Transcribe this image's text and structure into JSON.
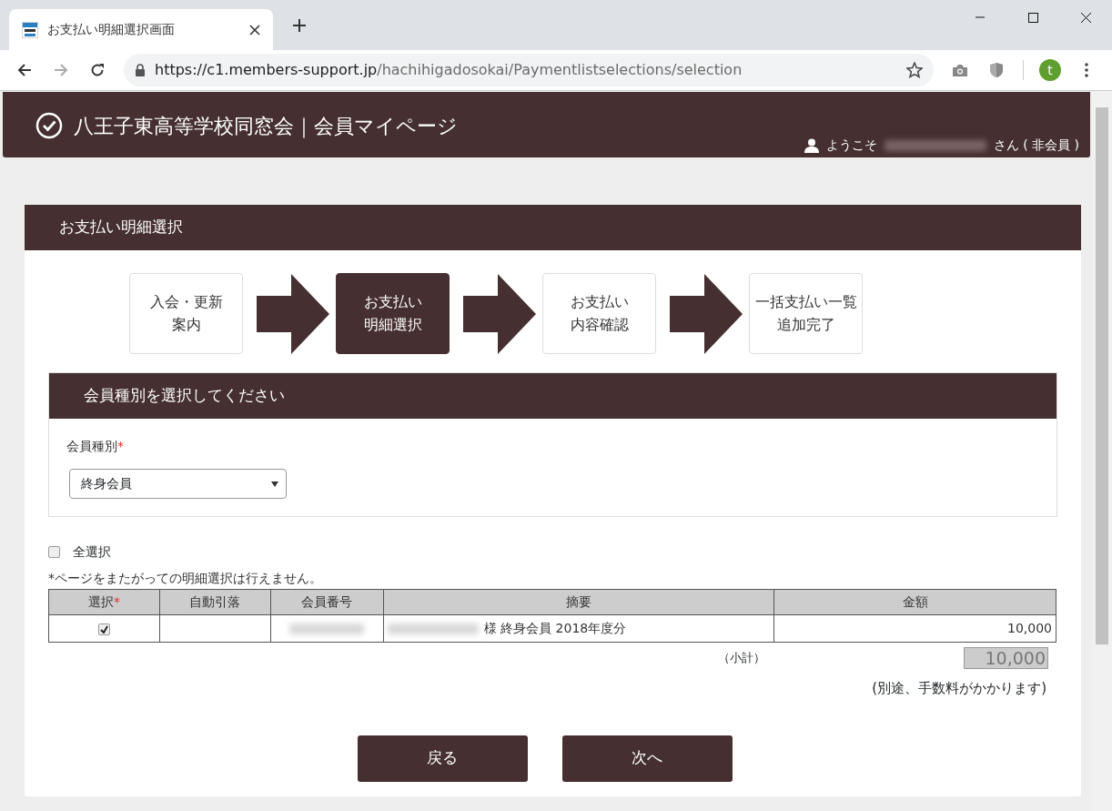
{
  "browser": {
    "tab_title": "お支払い明細選択画面",
    "url_host": "https://c1.members-support.jp",
    "url_path": "/hachihigadosokai/Paymentlistselections/selection",
    "profile_initial": "t"
  },
  "header": {
    "title": "八王子東高等学校同窓会｜会員マイページ",
    "welcome": "ようこそ",
    "name_redacted": true,
    "suffix": "さん ( 非会員 )"
  },
  "page_title": "お支払い明細選択",
  "steps": [
    {
      "lines": [
        "入会・更新",
        "案内"
      ],
      "selected": false
    },
    {
      "lines": [
        "お支払い",
        "明細選択"
      ],
      "selected": true
    },
    {
      "lines": [
        "お支払い",
        "内容確認"
      ],
      "selected": false
    },
    {
      "lines": [
        "一括支払い一覧",
        "追加完了"
      ],
      "selected": false
    }
  ],
  "section": {
    "title": "会員種別を選択してください",
    "field_label": "会員種別",
    "required_mark": "*",
    "select_value": "終身会員"
  },
  "select_all": {
    "label": "全選択",
    "checked": false
  },
  "note": "*ページをまたがっての明細選択は行えません。",
  "table": {
    "columns": [
      {
        "label": "選択",
        "mark": "*"
      },
      {
        "label": "自動引落"
      },
      {
        "label": "会員番号"
      },
      {
        "label": "摘要"
      },
      {
        "label": "金額"
      }
    ],
    "rows": [
      {
        "checked": true,
        "member_no_redacted": true,
        "name_redacted": true,
        "description": "様 終身会員 2018年度分",
        "amount": "10,000"
      }
    ]
  },
  "subtotal_label": "（小計）",
  "subtotal": "10,000",
  "fee_note": "(別途、手数料がかかります)",
  "buttons": [
    "戻る",
    "次へ"
  ]
}
